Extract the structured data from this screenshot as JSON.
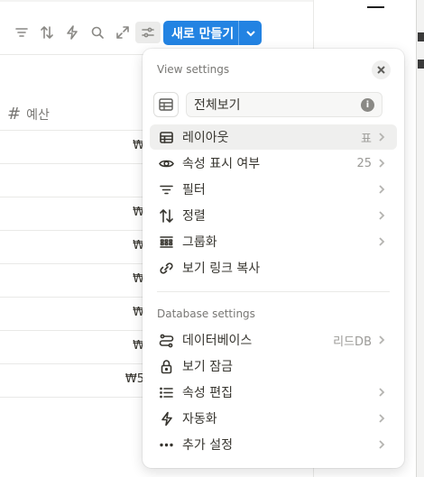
{
  "toolbar": {
    "icons": [
      "filter-icon",
      "sort-icon",
      "automation-icon",
      "search-icon",
      "expand-icon",
      "settings-icon"
    ],
    "new_button_label": "새로 만들기"
  },
  "table": {
    "column_header": "예산",
    "cells": [
      "₩",
      "",
      "₩",
      "₩",
      "₩",
      "₩",
      "₩",
      "₩5"
    ]
  },
  "popup": {
    "title": "View settings",
    "view_name": "전체보기",
    "view_items": [
      {
        "label": "레이아웃",
        "value": "표",
        "icon": "table-icon"
      },
      {
        "label": "속성 표시 여부",
        "value": "25",
        "icon": "eye-icon"
      },
      {
        "label": "필터",
        "value": "",
        "icon": "filter-icon"
      },
      {
        "label": "정렬",
        "value": "",
        "icon": "sort-icon"
      },
      {
        "label": "그룹화",
        "value": "",
        "icon": "group-icon"
      },
      {
        "label": "보기 링크 복사",
        "value": "",
        "icon": "link-icon"
      }
    ],
    "db_section_title": "Database settings",
    "db_items": [
      {
        "label": "데이터베이스",
        "value": "리드DB",
        "icon": "database-icon"
      },
      {
        "label": "보기 잠금",
        "value": "",
        "icon": "lock-icon"
      },
      {
        "label": "속성 편집",
        "value": "",
        "icon": "list-icon"
      },
      {
        "label": "자동화",
        "value": "",
        "icon": "automation-icon"
      },
      {
        "label": "추가 설정",
        "value": "",
        "icon": "more-icon"
      }
    ]
  },
  "colors": {
    "accent": "#2383e2",
    "highlight": "#efefee"
  }
}
